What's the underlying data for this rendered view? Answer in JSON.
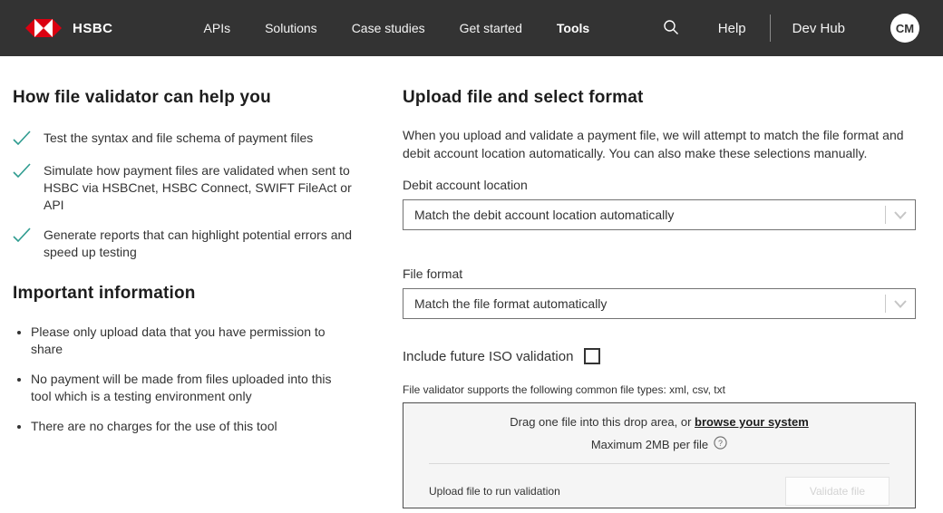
{
  "header": {
    "brand": "HSBC",
    "nav_items": [
      {
        "label": "APIs"
      },
      {
        "label": "Solutions"
      },
      {
        "label": "Case studies"
      },
      {
        "label": "Get started"
      },
      {
        "label": "Tools"
      }
    ],
    "active_nav": "Tools",
    "help_label": "Help",
    "portal_label": "Dev Hub",
    "avatar_initials": "CM"
  },
  "left_panel": {
    "benefits_heading": "How file validator can help you",
    "benefits": [
      {
        "text": "Test the syntax and file schema of payment files"
      },
      {
        "text": "Simulate how payment files are validated when sent to HSBC via HSBCnet, HSBC Connect, SWIFT FileAct or API"
      },
      {
        "text": "Generate reports that can highlight potential errors and speed up testing"
      }
    ],
    "info_heading": "Important information",
    "info_items": [
      {
        "text": "Please only upload data that you have permission to share"
      },
      {
        "text": "No payment will be made from files uploaded into this tool which is a testing environment only"
      },
      {
        "text": "There are no charges for the use of this tool"
      }
    ]
  },
  "upload_panel": {
    "heading": "Upload file and select format",
    "description": "When you upload and validate a payment file, we will attempt to match the file format and debit account location automatically. You can also make these selections manually.",
    "debit_account": {
      "label": "Debit account location",
      "value": "Match the debit account location automatically"
    },
    "file_format": {
      "label": "File format",
      "value": "Match the file format automatically"
    },
    "iso_checkbox": {
      "label": "Include future ISO validation",
      "checked": false
    },
    "file_types_note": "File validator supports the following common file types: xml, csv, txt",
    "dropzone": {
      "line1_prefix": "Drag one file into this drop area, or ",
      "browse_link": "browse your system",
      "max_size": "Maximum 2MB per file",
      "footer_text": "Upload file to run validation",
      "validate_button": "Validate file"
    }
  },
  "colors": {
    "brand_red": "#db0011",
    "header_bg": "#333333",
    "check_teal": "#2f9c90"
  }
}
